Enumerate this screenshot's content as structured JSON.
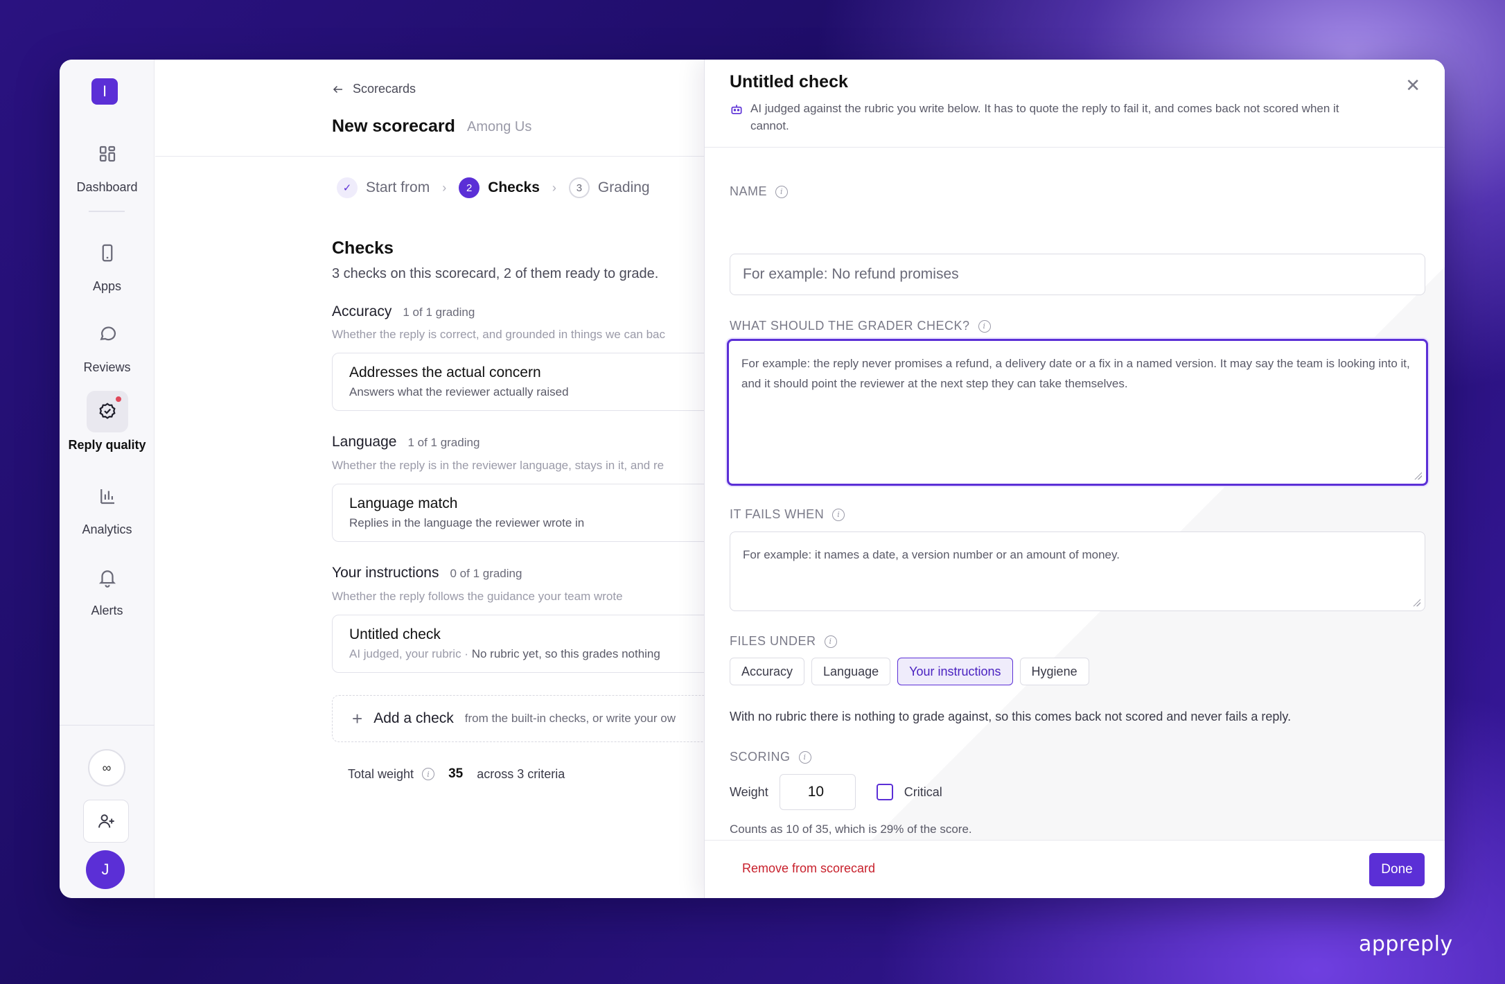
{
  "brand": "appreply",
  "sidebar": {
    "logo_letter": "I",
    "items": [
      {
        "label": "Dashboard",
        "icon": "dashboard-icon"
      },
      {
        "label": "Apps",
        "icon": "phone-icon"
      },
      {
        "label": "Reviews",
        "icon": "chat-bubble-icon"
      },
      {
        "label": "Reply quality",
        "icon": "badge-check-icon",
        "active": true
      },
      {
        "label": "Analytics",
        "icon": "bar-chart-icon"
      },
      {
        "label": "Alerts",
        "icon": "bell-icon"
      }
    ],
    "infinity_symbol": "∞",
    "avatar_letter": "J"
  },
  "main": {
    "breadcrumb": "Scorecards",
    "title": "New scorecard",
    "subtitle": "Among Us",
    "steps": [
      {
        "number": "✓",
        "label": "Start from",
        "state": "done"
      },
      {
        "number": "2",
        "label": "Checks",
        "state": "active"
      },
      {
        "number": "3",
        "label": "Grading",
        "state": "upcoming"
      }
    ],
    "section_title": "Checks",
    "section_subtitle": "3 checks on this scorecard, 2 of them ready to grade.",
    "groups": [
      {
        "name": "Accuracy",
        "count": "1 of 1 grading",
        "description": "Whether the reply is correct, and grounded in things we can bac",
        "check_title": "Addresses the actual concern",
        "check_sub": "Answers what the reviewer actually raised"
      },
      {
        "name": "Language",
        "count": "1 of 1 grading",
        "description": "Whether the reply is in the reviewer language, stays in it, and re",
        "check_title": "Language match",
        "check_sub": "Replies in the language the reviewer wrote in"
      },
      {
        "name": "Your instructions",
        "count": "0 of 1 grading",
        "description": "Whether the reply follows the guidance your team wrote",
        "check_title": "Untitled check",
        "check_sub_muted": "AI judged, your rubric · ",
        "check_sub": "No rubric yet, so this grades nothing"
      }
    ],
    "add_check_label": "Add a check",
    "add_check_sub": "from the built-in checks, or write your ow",
    "total_label": "Total weight",
    "total_value": "35",
    "total_suffix": "across 3 criteria"
  },
  "panel": {
    "title": "Untitled check",
    "description": "AI judged against the rubric you write below. It has to quote the reply to fail it, and comes back not scored when it cannot.",
    "name_label": "NAME",
    "name_placeholder": "For example: No refund promises",
    "grader_label": "WHAT SHOULD THE GRADER CHECK?",
    "grader_placeholder": "For example: the reply never promises a refund, a delivery date or a fix in a named version. It may say the team is looking into it, and it should point the reviewer at the next step they can take themselves.",
    "fails_label": "IT FAILS WHEN",
    "fails_placeholder": "For example: it names a date, a version number or an amount of money.",
    "files_label": "FILES UNDER",
    "categories": [
      "Accuracy",
      "Language",
      "Your instructions",
      "Hygiene"
    ],
    "selected_category": "Your instructions",
    "no_rubric_note": "With no rubric there is nothing to grade against, so this comes back not scored and never fails a reply.",
    "scoring_label": "SCORING",
    "weight_label": "Weight",
    "weight_value": "10",
    "critical_label": "Critical",
    "weight_note": "Counts as 10 of 35, which is 29% of the score.",
    "remove_label": "Remove from scorecard",
    "done_label": "Done"
  }
}
